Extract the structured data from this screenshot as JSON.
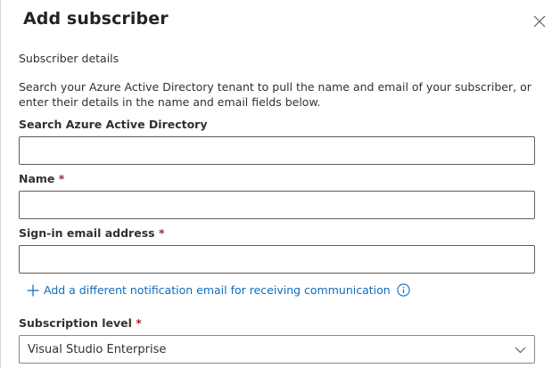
{
  "dialog": {
    "title": "Add subscriber",
    "section_label": "Subscriber details",
    "description": "Search your Azure Active Directory tenant to pull the name and email of your subscriber, or enter their details in the name and email fields below."
  },
  "fields": {
    "search": {
      "label": "Search Azure Active Directory",
      "value": ""
    },
    "name": {
      "label": "Name",
      "required_marker": "*",
      "value": ""
    },
    "email": {
      "label": "Sign-in email address",
      "required_marker": "*",
      "value": ""
    }
  },
  "add_notification_link": {
    "icon": "plus-icon",
    "label": "Add a different notification email for receiving communication"
  },
  "subscription_level": {
    "label": "Subscription level",
    "required_marker": "*",
    "selected": "Visual Studio Enterprise"
  },
  "icons": {
    "close": "close-icon",
    "info": "info-icon",
    "dropdown": "chevron-down-icon"
  },
  "colors": {
    "link": "#0f6cbd",
    "required": "#a4262c",
    "text": "#323130"
  }
}
